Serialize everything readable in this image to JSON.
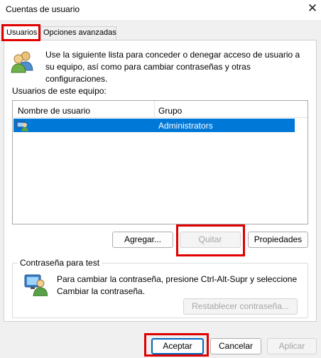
{
  "window": {
    "title": "Cuentas de usuario",
    "close_glyph": "✕"
  },
  "tabs": [
    {
      "label": "Usuarios",
      "active": true
    },
    {
      "label": "Opciones avanzadas",
      "active": false
    }
  ],
  "users_tab": {
    "description": "Use la siguiente lista para conceder o denegar acceso de usuario a su equipo, así como para cambiar contraseñas y otras configuraciones.",
    "list_label": "Usuarios de este equipo:",
    "columns": [
      "Nombre de usuario",
      "Grupo"
    ],
    "rows": [
      {
        "name": "",
        "group": "Administrators",
        "selected": true
      }
    ],
    "buttons": {
      "add": "Agregar...",
      "remove": "Quitar",
      "properties": "Propiedades"
    }
  },
  "password_group": {
    "legend": "Contraseña para test",
    "description": "Para cambiar la contraseña, presione Ctrl-Alt-Supr y seleccione Cambiar la contraseña.",
    "reset_button": "Restablecer contraseña..."
  },
  "footer": {
    "ok": "Aceptar",
    "cancel": "Cancelar",
    "apply": "Aplicar"
  },
  "colors": {
    "selection": "#0078d7",
    "highlight_border": "#e00000",
    "accent": "#0067c0"
  },
  "icons": [
    "close-icon",
    "users-icon",
    "user-row-icon",
    "password-icon"
  ]
}
